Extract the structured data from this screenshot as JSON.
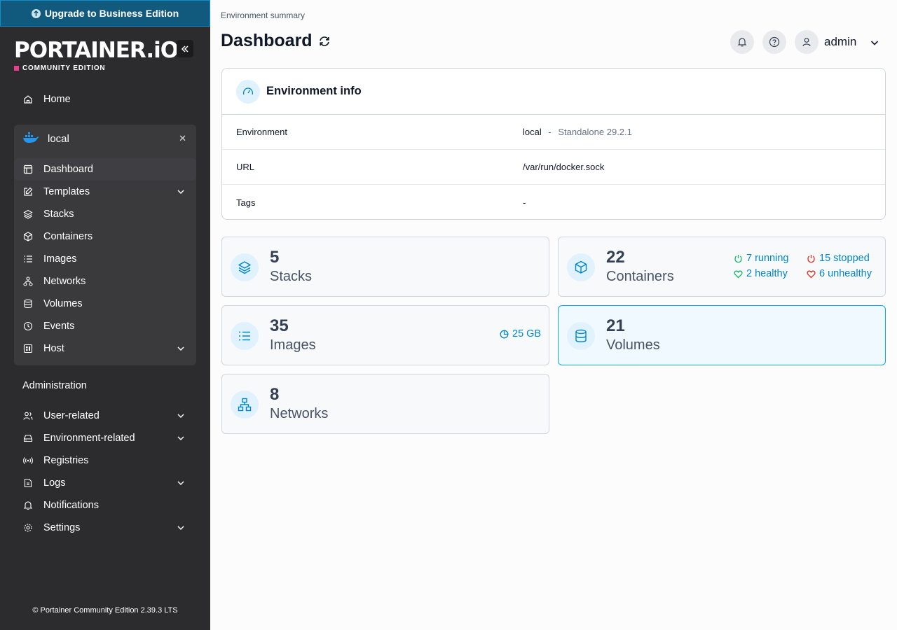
{
  "upgrade_banner": "Upgrade to Business Edition",
  "brand": {
    "logo": "PORTAINER.iO",
    "edition": "COMMUNITY EDITION"
  },
  "sidebar": {
    "home": "Home",
    "environment": {
      "name": "local",
      "items": [
        "Dashboard",
        "Templates",
        "Stacks",
        "Containers",
        "Images",
        "Networks",
        "Volumes",
        "Events",
        "Host"
      ]
    },
    "administration_title": "Administration",
    "admin_items": [
      "User-related",
      "Environment-related",
      "Registries",
      "Logs",
      "Notifications",
      "Settings"
    ],
    "footer": "© Portainer Community Edition  2.39.3 LTS"
  },
  "header": {
    "breadcrumb": "Environment summary",
    "title": "Dashboard",
    "username": "admin"
  },
  "environment_info": {
    "title": "Environment info",
    "rows": [
      {
        "key": "Environment",
        "value": "local",
        "sep": "-",
        "extra": "Standalone 29.2.1"
      },
      {
        "key": "URL",
        "value": "/var/run/docker.sock"
      },
      {
        "key": "Tags",
        "value": "-"
      }
    ]
  },
  "stats": {
    "stacks": {
      "count": "5",
      "label": "Stacks"
    },
    "containers": {
      "count": "22",
      "label": "Containers",
      "running": "7 running",
      "stopped": "15 stopped",
      "healthy": "2 healthy",
      "unhealthy": "6 unhealthy"
    },
    "images": {
      "count": "35",
      "label": "Images",
      "size": "25 GB"
    },
    "volumes": {
      "count": "21",
      "label": "Volumes"
    },
    "networks": {
      "count": "8",
      "label": "Networks"
    }
  },
  "colors": {
    "sidebar_bg": "#2c2c2e",
    "accent": "#0086c9",
    "running": "#12b76a",
    "stopped": "#d92d20",
    "brand_pink": "#e83e8c"
  }
}
